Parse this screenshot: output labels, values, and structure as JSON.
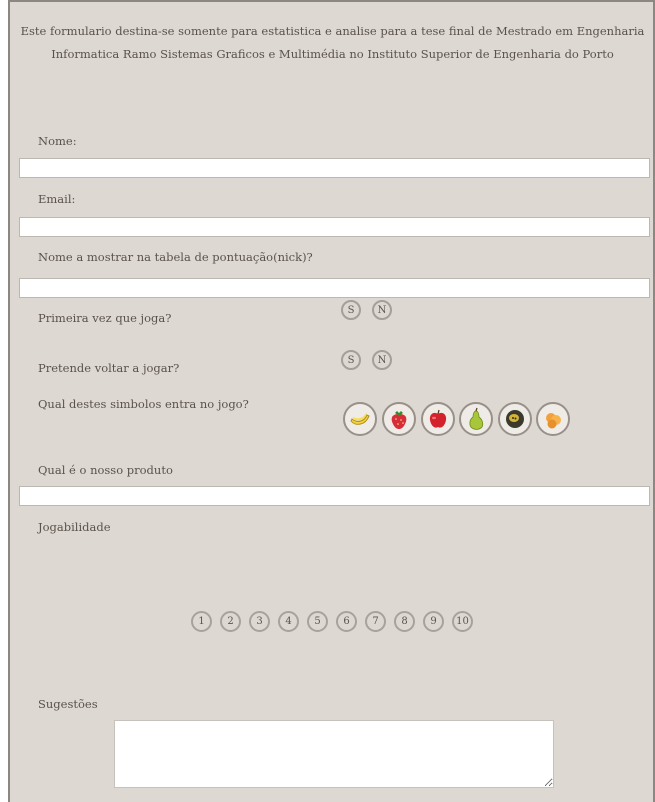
{
  "intro": "Este formulario destina-se somente para estatistica e analise para a tese final de Mestrado em Engenharia Informatica Ramo Sistemas Graficos e Multimédia no Instituto Superior de Engenharia do Porto",
  "fields": {
    "nome": "Nome:",
    "email": "Email:",
    "nick": "Nome a mostrar na tabela de pontuação(nick)?",
    "primeira": "Primeira vez que joga?",
    "voltar": "Pretende voltar a jogar?",
    "simbolos": "Qual destes simbolos entra no jogo?",
    "produto": "Qual é o nosso produto",
    "jogabilidade": "Jogabilidade",
    "sugestoes": "Sugestões"
  },
  "options": {
    "sim": "S",
    "nao": "N"
  },
  "fruits": [
    "banana-icon",
    "strawberry-icon",
    "apple-icon",
    "pear-icon",
    "passionfruit-icon",
    "orange-icon"
  ],
  "scale": [
    "1",
    "2",
    "3",
    "4",
    "5",
    "6",
    "7",
    "8",
    "9",
    "10"
  ]
}
